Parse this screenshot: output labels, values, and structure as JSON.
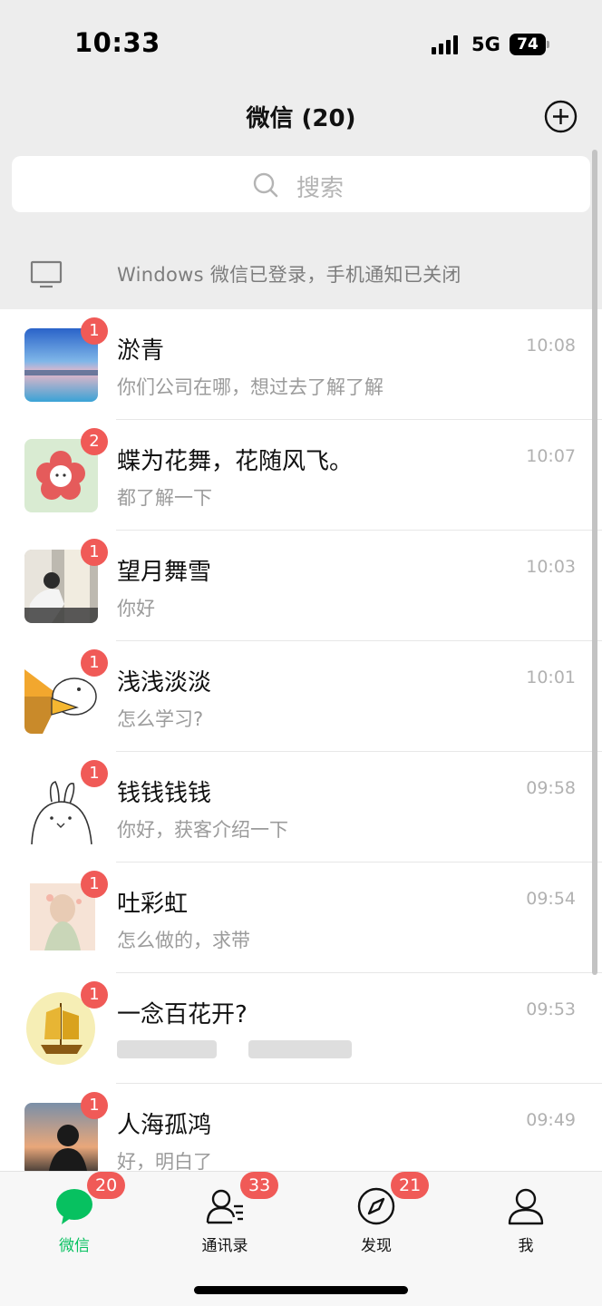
{
  "status_bar": {
    "time": "10:33",
    "network": "5G",
    "battery": "74"
  },
  "header": {
    "title": "微信 (20)",
    "add_icon": "plus-circle-icon"
  },
  "search": {
    "placeholder": "搜索"
  },
  "device_notice": {
    "text": "Windows 微信已登录，手机通知已关闭",
    "icon": "monitor-icon"
  },
  "chats": [
    {
      "name": "淤青",
      "preview": "你们公司在哪，想过去了解了解",
      "time": "10:08",
      "unread": "1"
    },
    {
      "name": "蝶为花舞，花随风飞。",
      "preview": "都了解一下",
      "time": "10:07",
      "unread": "2"
    },
    {
      "name": "望月舞雪",
      "preview": "你好",
      "time": "10:03",
      "unread": "1"
    },
    {
      "name": "浅浅淡淡",
      "preview": "怎么学习?",
      "time": "10:01",
      "unread": "1"
    },
    {
      "name": "钱钱钱钱",
      "preview": "你好，获客介绍一下",
      "time": "09:58",
      "unread": "1"
    },
    {
      "name": "吐彩虹",
      "preview": "怎么做的，求带",
      "time": "09:54",
      "unread": "1"
    },
    {
      "name": "一念百花开?",
      "preview": "",
      "time": "09:53",
      "unread": "1"
    },
    {
      "name": "人海孤鸿",
      "preview": "好，明白了",
      "time": "09:49",
      "unread": "1"
    }
  ],
  "tabs": [
    {
      "label": "微信",
      "badge": "20",
      "icon": "chat-bubble-icon",
      "active": true
    },
    {
      "label": "通讯录",
      "badge": "33",
      "icon": "contacts-icon",
      "active": false
    },
    {
      "label": "发现",
      "badge": "21",
      "icon": "compass-icon",
      "active": false
    },
    {
      "label": "我",
      "badge": "",
      "icon": "person-icon",
      "active": false
    }
  ],
  "colors": {
    "accent": "#07c160",
    "badge": "#f05a57",
    "background": "#ededed"
  }
}
